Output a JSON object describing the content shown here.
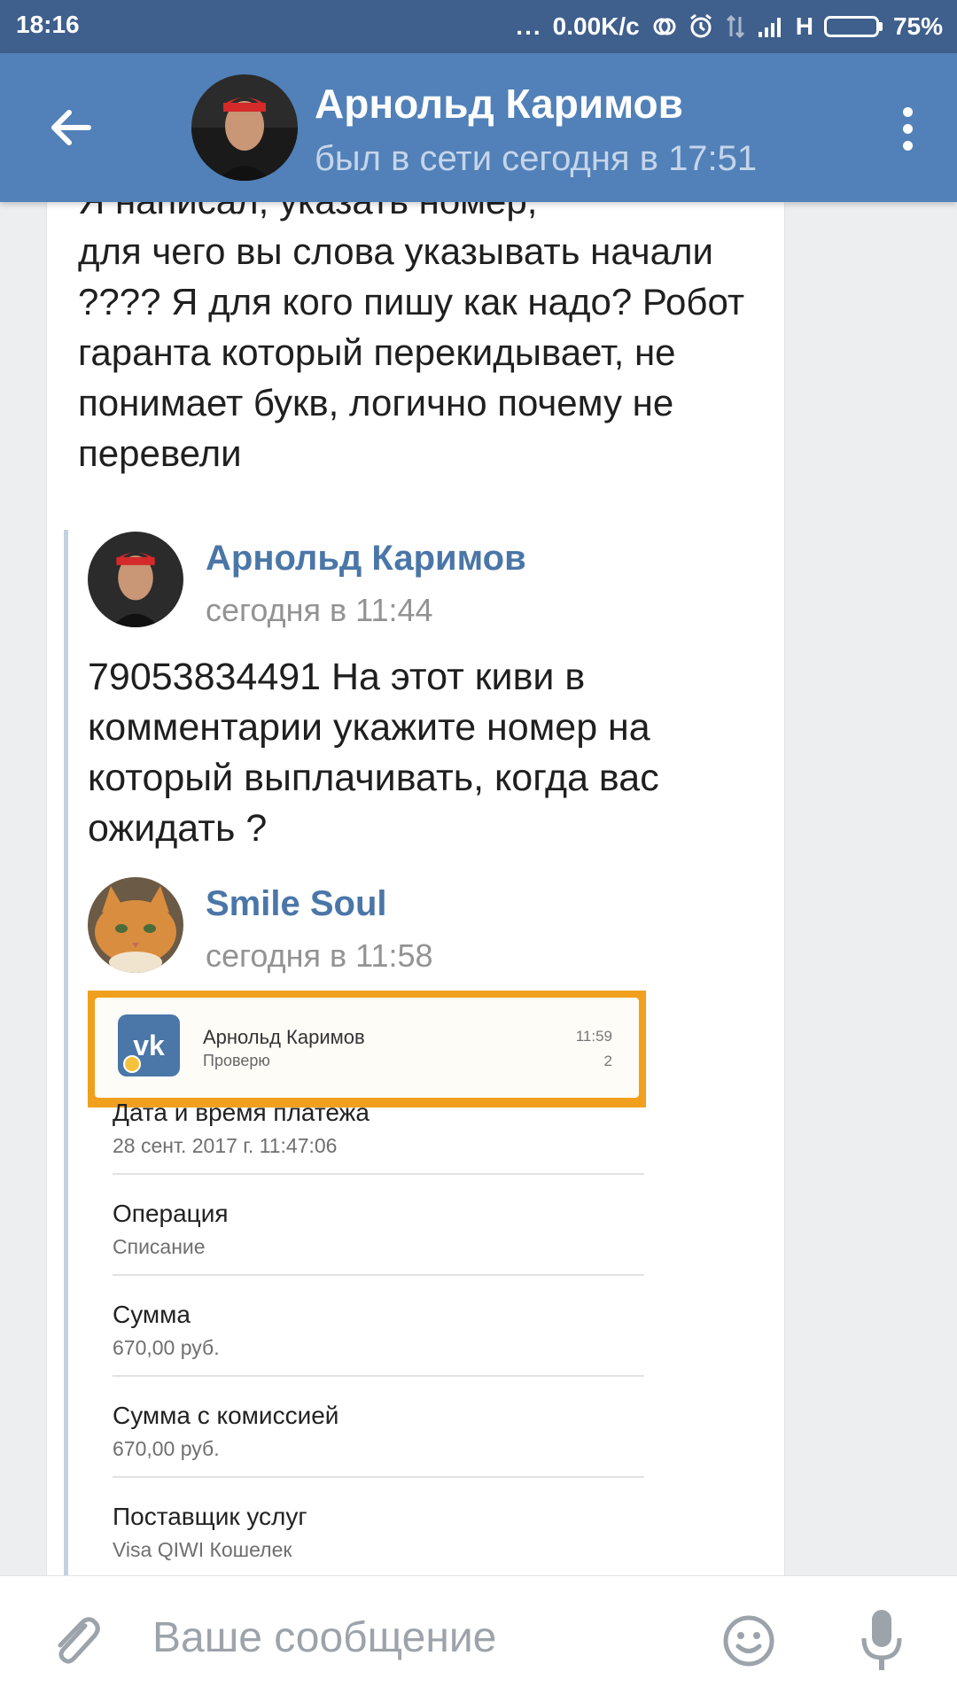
{
  "status_bar": {
    "time": "18:16",
    "dots": "...",
    "net_speed": "0.00K/c",
    "network_type": "H",
    "battery_percent": "75%",
    "battery_level": 0.75,
    "icons": [
      "sync-icon",
      "alarm-icon",
      "data-transfer-icon",
      "signal-icon",
      "battery-icon"
    ]
  },
  "header": {
    "contact_name": "Арнольд Каримов",
    "last_seen": "был в сети сегодня в 17:51",
    "back_icon": "arrow-left-icon",
    "menu_icon": "more-vertical-icon",
    "bg_color": "#5181b8"
  },
  "message": {
    "text": "Я написал, указать номер,\nдля чего вы слова указывать начали ???? Я для кого пишу как надо? Робот гаранта который перекидывает, не понимает букв, логично почему не перевели"
  },
  "forwarded": [
    {
      "author": "Арнольд Каримов",
      "time": "сегодня в 11:44",
      "text": "79053834491 На этот киви в комментарии укажите номер на который выплачивать, когда вас ожидать ?"
    },
    {
      "author": "Smile Soul",
      "time": "сегодня в 11:58"
    }
  ],
  "attachment": {
    "notification": {
      "app_icon": "vk-logo-icon",
      "app_icon_text": "vk",
      "title": "Арнольд Каримов",
      "subtitle": "Проверю",
      "time": "11:59",
      "count": "2",
      "frame_color": "#f0a01e"
    },
    "rows": [
      {
        "label": "Дата и время платежа",
        "value": "28 сент. 2017 г. 11:47:06"
      },
      {
        "label": "Операция",
        "value": "Списание"
      },
      {
        "label": "Сумма",
        "value": "670,00 руб."
      },
      {
        "label": "Сумма с комиссией",
        "value": "670,00 руб."
      },
      {
        "label": "Поставщик услуг",
        "value": "Visa QIWI Кошелек"
      }
    ]
  },
  "composer": {
    "placeholder": "Ваше сообщение",
    "attach_icon": "paperclip-icon",
    "emoji_icon": "emoji-icon",
    "mic_icon": "microphone-icon"
  }
}
